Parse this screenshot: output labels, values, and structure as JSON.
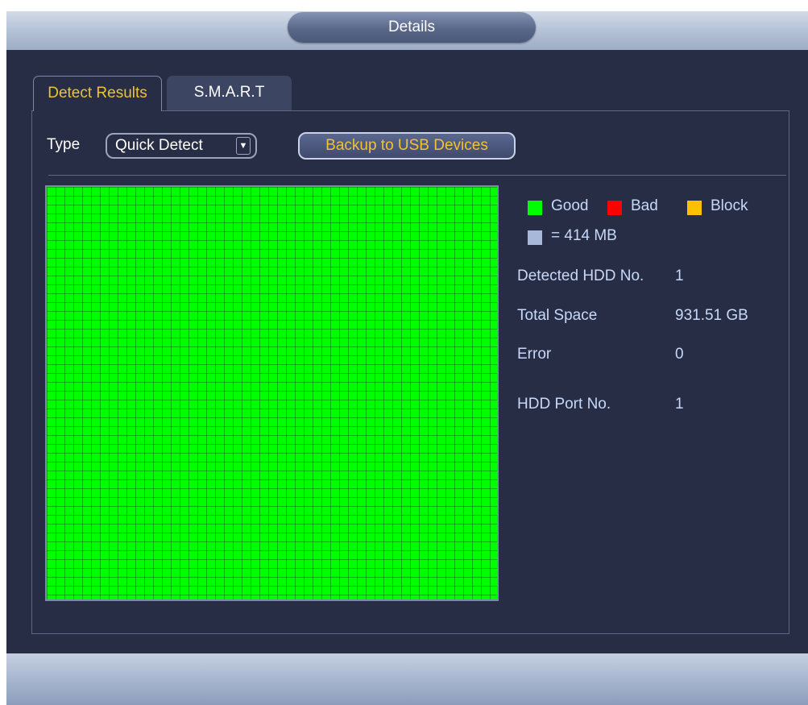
{
  "window": {
    "title": "Details"
  },
  "tabs": {
    "detect_results": "Detect Results",
    "smart": "S.M.A.R.T"
  },
  "toolbar": {
    "type_label": "Type",
    "type_value": "Quick Detect",
    "backup_label": "Backup to USB Devices"
  },
  "legend": {
    "good": "Good",
    "bad": "Bad",
    "block": "Block",
    "unit": "= 414 MB",
    "colors": {
      "good": "#00ff00",
      "bad": "#ff0000",
      "block": "#ffc000",
      "unit": "#a8b8d8"
    }
  },
  "info": {
    "detected_hdd_label": "Detected HDD No.",
    "detected_hdd_value": "1",
    "total_space_label": "Total Space",
    "total_space_value": "931.51 GB",
    "error_label": "Error",
    "error_value": "0",
    "port_label": "HDD Port No.",
    "port_value": "1"
  },
  "colors": {
    "accent_text": "#f1c232",
    "window_bg": "#262d44"
  }
}
